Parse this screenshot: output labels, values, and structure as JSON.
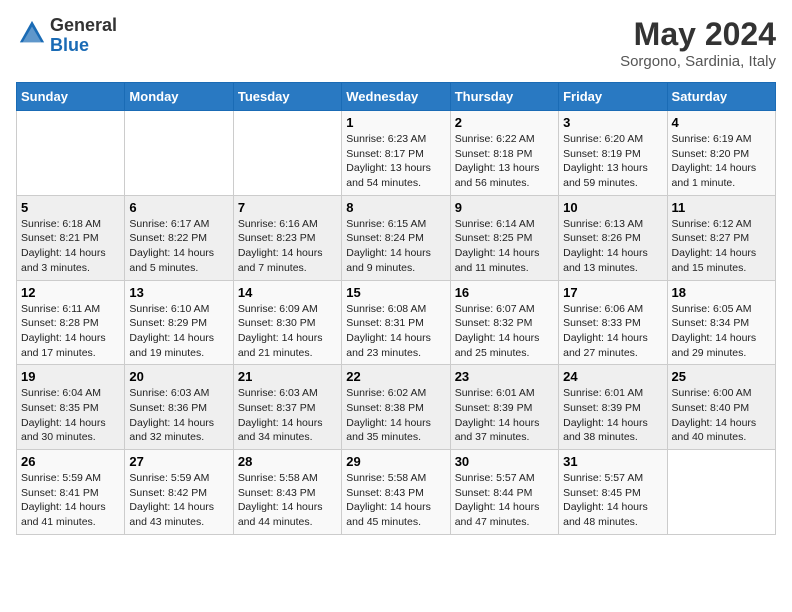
{
  "header": {
    "logo_general": "General",
    "logo_blue": "Blue",
    "month": "May 2024",
    "location": "Sorgono, Sardinia, Italy"
  },
  "weekdays": [
    "Sunday",
    "Monday",
    "Tuesday",
    "Wednesday",
    "Thursday",
    "Friday",
    "Saturday"
  ],
  "weeks": [
    [
      {
        "day": "",
        "info": ""
      },
      {
        "day": "",
        "info": ""
      },
      {
        "day": "",
        "info": ""
      },
      {
        "day": "1",
        "info": "Sunrise: 6:23 AM\nSunset: 8:17 PM\nDaylight: 13 hours and 54 minutes."
      },
      {
        "day": "2",
        "info": "Sunrise: 6:22 AM\nSunset: 8:18 PM\nDaylight: 13 hours and 56 minutes."
      },
      {
        "day": "3",
        "info": "Sunrise: 6:20 AM\nSunset: 8:19 PM\nDaylight: 13 hours and 59 minutes."
      },
      {
        "day": "4",
        "info": "Sunrise: 6:19 AM\nSunset: 8:20 PM\nDaylight: 14 hours and 1 minute."
      }
    ],
    [
      {
        "day": "5",
        "info": "Sunrise: 6:18 AM\nSunset: 8:21 PM\nDaylight: 14 hours and 3 minutes."
      },
      {
        "day": "6",
        "info": "Sunrise: 6:17 AM\nSunset: 8:22 PM\nDaylight: 14 hours and 5 minutes."
      },
      {
        "day": "7",
        "info": "Sunrise: 6:16 AM\nSunset: 8:23 PM\nDaylight: 14 hours and 7 minutes."
      },
      {
        "day": "8",
        "info": "Sunrise: 6:15 AM\nSunset: 8:24 PM\nDaylight: 14 hours and 9 minutes."
      },
      {
        "day": "9",
        "info": "Sunrise: 6:14 AM\nSunset: 8:25 PM\nDaylight: 14 hours and 11 minutes."
      },
      {
        "day": "10",
        "info": "Sunrise: 6:13 AM\nSunset: 8:26 PM\nDaylight: 14 hours and 13 minutes."
      },
      {
        "day": "11",
        "info": "Sunrise: 6:12 AM\nSunset: 8:27 PM\nDaylight: 14 hours and 15 minutes."
      }
    ],
    [
      {
        "day": "12",
        "info": "Sunrise: 6:11 AM\nSunset: 8:28 PM\nDaylight: 14 hours and 17 minutes."
      },
      {
        "day": "13",
        "info": "Sunrise: 6:10 AM\nSunset: 8:29 PM\nDaylight: 14 hours and 19 minutes."
      },
      {
        "day": "14",
        "info": "Sunrise: 6:09 AM\nSunset: 8:30 PM\nDaylight: 14 hours and 21 minutes."
      },
      {
        "day": "15",
        "info": "Sunrise: 6:08 AM\nSunset: 8:31 PM\nDaylight: 14 hours and 23 minutes."
      },
      {
        "day": "16",
        "info": "Sunrise: 6:07 AM\nSunset: 8:32 PM\nDaylight: 14 hours and 25 minutes."
      },
      {
        "day": "17",
        "info": "Sunrise: 6:06 AM\nSunset: 8:33 PM\nDaylight: 14 hours and 27 minutes."
      },
      {
        "day": "18",
        "info": "Sunrise: 6:05 AM\nSunset: 8:34 PM\nDaylight: 14 hours and 29 minutes."
      }
    ],
    [
      {
        "day": "19",
        "info": "Sunrise: 6:04 AM\nSunset: 8:35 PM\nDaylight: 14 hours and 30 minutes."
      },
      {
        "day": "20",
        "info": "Sunrise: 6:03 AM\nSunset: 8:36 PM\nDaylight: 14 hours and 32 minutes."
      },
      {
        "day": "21",
        "info": "Sunrise: 6:03 AM\nSunset: 8:37 PM\nDaylight: 14 hours and 34 minutes."
      },
      {
        "day": "22",
        "info": "Sunrise: 6:02 AM\nSunset: 8:38 PM\nDaylight: 14 hours and 35 minutes."
      },
      {
        "day": "23",
        "info": "Sunrise: 6:01 AM\nSunset: 8:39 PM\nDaylight: 14 hours and 37 minutes."
      },
      {
        "day": "24",
        "info": "Sunrise: 6:01 AM\nSunset: 8:39 PM\nDaylight: 14 hours and 38 minutes."
      },
      {
        "day": "25",
        "info": "Sunrise: 6:00 AM\nSunset: 8:40 PM\nDaylight: 14 hours and 40 minutes."
      }
    ],
    [
      {
        "day": "26",
        "info": "Sunrise: 5:59 AM\nSunset: 8:41 PM\nDaylight: 14 hours and 41 minutes."
      },
      {
        "day": "27",
        "info": "Sunrise: 5:59 AM\nSunset: 8:42 PM\nDaylight: 14 hours and 43 minutes."
      },
      {
        "day": "28",
        "info": "Sunrise: 5:58 AM\nSunset: 8:43 PM\nDaylight: 14 hours and 44 minutes."
      },
      {
        "day": "29",
        "info": "Sunrise: 5:58 AM\nSunset: 8:43 PM\nDaylight: 14 hours and 45 minutes."
      },
      {
        "day": "30",
        "info": "Sunrise: 5:57 AM\nSunset: 8:44 PM\nDaylight: 14 hours and 47 minutes."
      },
      {
        "day": "31",
        "info": "Sunrise: 5:57 AM\nSunset: 8:45 PM\nDaylight: 14 hours and 48 minutes."
      },
      {
        "day": "",
        "info": ""
      }
    ]
  ]
}
